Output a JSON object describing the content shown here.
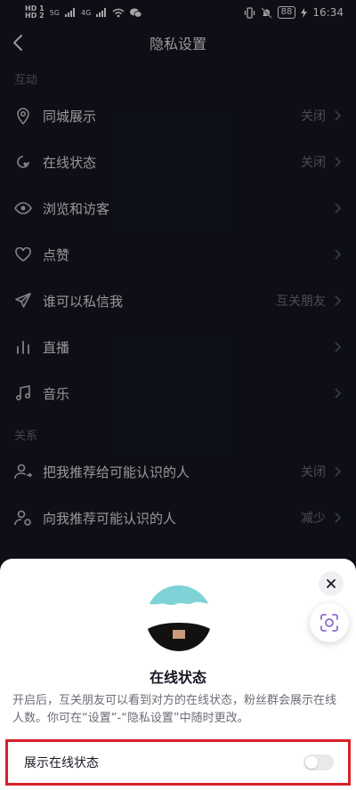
{
  "status_bar": {
    "left_hd1": "HD 1",
    "left_hd2": "HD 2",
    "net1": "5G",
    "net2": "4G",
    "battery": "88",
    "time": "16:34"
  },
  "nav": {
    "title": "隐私设置"
  },
  "sections": [
    {
      "label": "互动",
      "items": [
        {
          "label": "同城展示",
          "value": "关闭",
          "icon": "location-icon"
        },
        {
          "label": "在线状态",
          "value": "关闭",
          "icon": "online-status-icon"
        },
        {
          "label": "浏览和访客",
          "value": "",
          "icon": "eye-icon"
        },
        {
          "label": "点赞",
          "value": "",
          "icon": "heart-icon"
        },
        {
          "label": "谁可以私信我",
          "value": "互关朋友",
          "icon": "send-icon"
        },
        {
          "label": "直播",
          "value": "",
          "icon": "live-bars-icon"
        },
        {
          "label": "音乐",
          "value": "",
          "icon": "music-note-icon"
        }
      ]
    },
    {
      "label": "关系",
      "items": [
        {
          "label": "把我推荐给可能认识的人",
          "value": "关闭",
          "icon": "recommend-me-icon"
        },
        {
          "label": "向我推荐可能认识的人",
          "value": "减少",
          "icon": "recommend-to-me-icon"
        }
      ]
    }
  ],
  "sheet": {
    "title": "在线状态",
    "description": "开启后，互关朋友可以看到对方的在线状态，粉丝群会展示在线人数。你可在“设置”-“隐私设置”中随时更改。",
    "toggle_label": "展示在线状态",
    "toggle_on": false
  },
  "colors": {
    "background": "#161823",
    "highlight_border": "#d8202a"
  }
}
